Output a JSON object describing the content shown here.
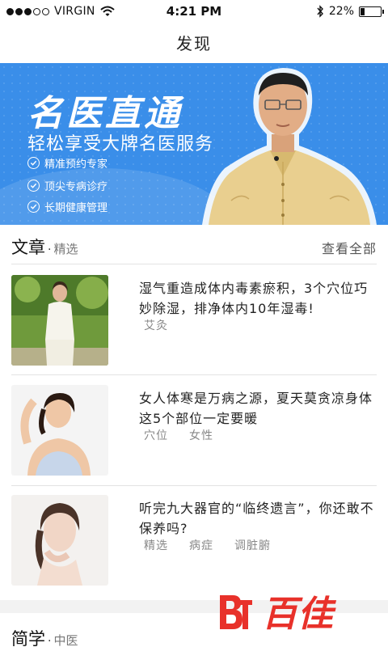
{
  "status_bar": {
    "carrier": "VIRGIN",
    "time": "4:21 PM",
    "battery_text": "22%",
    "battery_level": 0.22,
    "signal_bars_filled": 3,
    "signal_bars_total": 5,
    "icons": [
      "wifi-icon",
      "bluetooth-icon",
      "battery-icon"
    ]
  },
  "nav": {
    "title": "发现"
  },
  "banner": {
    "headline": "名医直通",
    "subtitle": "轻松享受大牌名医服务",
    "features": [
      "精准预约专家",
      "顶尖专病诊疗",
      "长期健康管理"
    ],
    "background_color": "#3a8ee9"
  },
  "articles_section": {
    "title": "文章",
    "subtitle": "精选",
    "view_all": "查看全部"
  },
  "articles": [
    {
      "title": "湿气重造成体内毒素瘀积，3个穴位巧妙除湿，排净体内10年湿毒!",
      "tags": [
        "艾灸"
      ]
    },
    {
      "title": "女人体寒是万病之源，夏天莫贪凉身体这5个部位一定要暖",
      "tags": [
        "穴位",
        "女性"
      ]
    },
    {
      "title": "听完九大器官的“临终遗言”，你还敢不保养吗?",
      "tags": [
        "精选",
        "病症",
        "调脏腑"
      ]
    }
  ],
  "courses_section": {
    "title": "简学",
    "subtitle": "中医"
  },
  "watermark": {
    "text": "百佳"
  }
}
